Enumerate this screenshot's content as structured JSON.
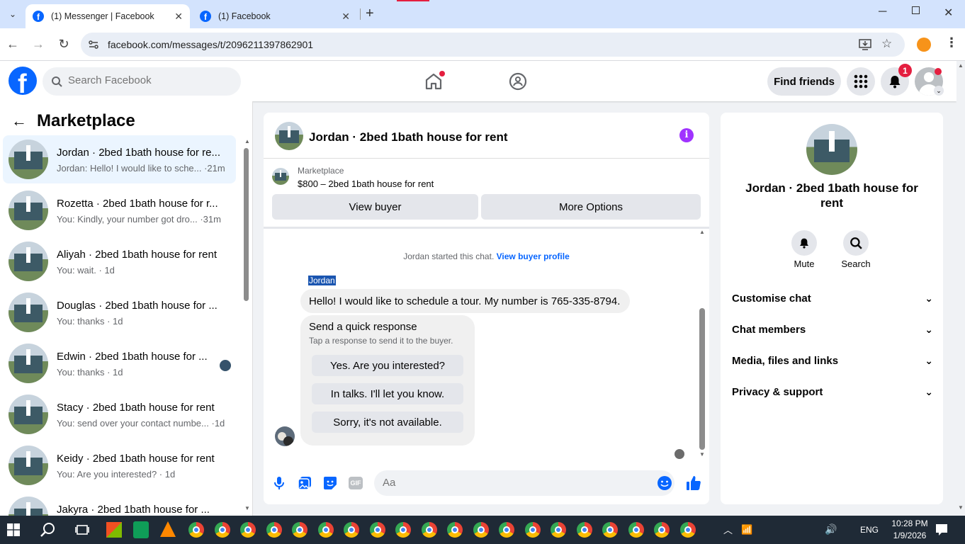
{
  "browser": {
    "tabs": [
      {
        "title": "(1) Messenger | Facebook",
        "active": true
      },
      {
        "title": "(1) Facebook",
        "active": false
      }
    ],
    "url": "facebook.com/messages/t/2096211397862901"
  },
  "header": {
    "search_placeholder": "Search Facebook",
    "find_friends": "Find friends",
    "notification_count": "1"
  },
  "sidebar": {
    "title": "Marketplace",
    "conversations": [
      {
        "name": "Jordan · 2bed 1bath house for re...",
        "snippet": "Jordan: Hello! I would like to sche... ·21m"
      },
      {
        "name": "Rozetta · 2bed 1bath house for r...",
        "snippet": "You: Kindly, your number got dro... ·31m"
      },
      {
        "name": "Aliyah · 2bed 1bath house for rent",
        "snippet": "You: wait. · 1d"
      },
      {
        "name": "Douglas · 2bed 1bath house for ...",
        "snippet": "You: thanks · 1d"
      },
      {
        "name": "Edwin · 2bed 1bath house for ...",
        "snippet": "You: thanks · 1d"
      },
      {
        "name": "Stacy · 2bed 1bath house for rent",
        "snippet": "You: send over your contact numbe... ·1d"
      },
      {
        "name": "Keidy · 2bed 1bath house for rent",
        "snippet": "You: Are you interested? · 1d"
      },
      {
        "name": "Jakyra · 2bed 1bath house for ...",
        "snippet": ""
      }
    ]
  },
  "chat": {
    "title": "Jordan · 2bed 1bath house for rent",
    "listing_label": "Marketplace",
    "listing_title": "$800 – 2bed 1bath house for rent",
    "view_buyer": "View buyer",
    "more_options": "More Options",
    "started_text": "Jordan started this chat.",
    "view_buyer_profile": "View buyer profile",
    "sender_name": "Jordan",
    "message": "Hello! I would like to schedule a tour. My number is 765-335-8794.",
    "quick_response_title": "Send a quick response",
    "quick_response_sub": "Tap a response to send it to the buyer.",
    "quick_responses": [
      "Yes. Are you interested?",
      "In talks. I'll let you know.",
      "Sorry, it's not available."
    ],
    "input_placeholder": "Aa",
    "gif_label": "GIF"
  },
  "details": {
    "title": "Jordan · 2bed 1bath house for rent",
    "mute": "Mute",
    "search": "Search",
    "sections": [
      "Customise chat",
      "Chat members",
      "Media, files and links",
      "Privacy & support"
    ]
  },
  "taskbar": {
    "language": "ENG",
    "time": "10:28 PM",
    "date": "1/9/2026"
  },
  "colors": {
    "fb_blue": "#0866ff",
    "messenger_purple": "#a033ff",
    "active_row": "#ebf5ff"
  }
}
